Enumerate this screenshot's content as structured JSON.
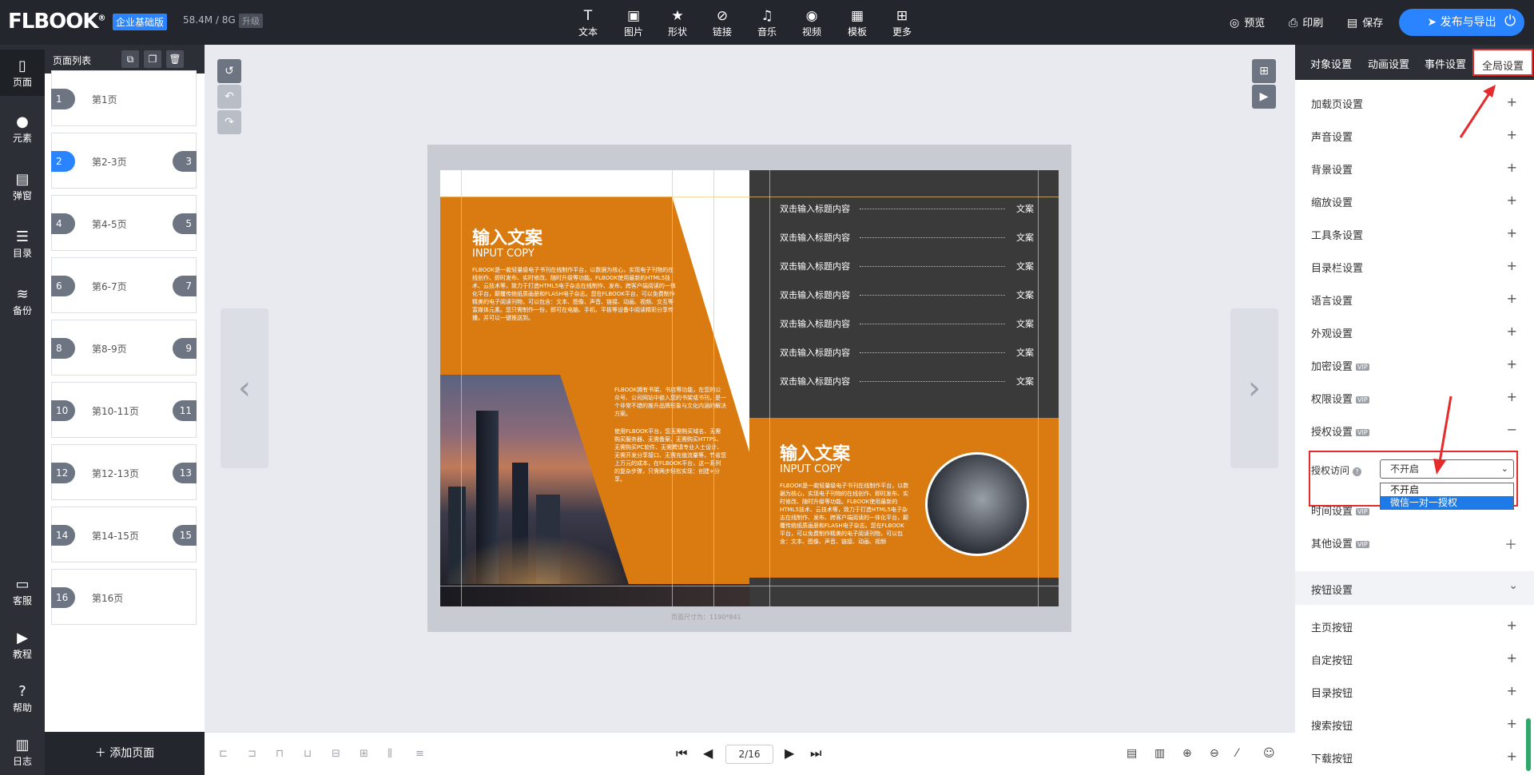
{
  "topbar": {
    "logo": "FLBOOK",
    "plan_badge": "企业基础版",
    "storage": "58.4M / 8G",
    "upgrade": "升级",
    "tools": [
      {
        "icon": "text-icon",
        "label": "文本"
      },
      {
        "icon": "image-icon",
        "label": "图片"
      },
      {
        "icon": "shape-icon",
        "label": "形状"
      },
      {
        "icon": "link-icon",
        "label": "链接"
      },
      {
        "icon": "music-icon",
        "label": "音乐"
      },
      {
        "icon": "video-icon",
        "label": "视频"
      },
      {
        "icon": "template-icon",
        "label": "模板"
      },
      {
        "icon": "more-icon",
        "label": "更多"
      }
    ],
    "preview": "预览",
    "print": "印刷",
    "save": "保存",
    "publish": "发布与导出"
  },
  "leftnav": [
    {
      "icon": "page-icon",
      "label": "页面"
    },
    {
      "icon": "element-icon",
      "label": "元素"
    },
    {
      "icon": "popup-icon",
      "label": "弹窗"
    },
    {
      "icon": "toc-icon",
      "label": "目录"
    },
    {
      "icon": "backup-icon",
      "label": "备份"
    },
    {
      "icon": "service-icon",
      "label": "客服"
    },
    {
      "icon": "tutorial-icon",
      "label": "教程"
    },
    {
      "icon": "help-icon",
      "label": "帮助"
    },
    {
      "icon": "log-icon",
      "label": "日志"
    }
  ],
  "pagelist": {
    "title": "页面列表",
    "pages": [
      {
        "left": "1",
        "right": "",
        "label": "第1页",
        "active": false
      },
      {
        "left": "2",
        "right": "3",
        "label": "第2-3页",
        "active": true
      },
      {
        "left": "4",
        "right": "5",
        "label": "第4-5页",
        "active": false
      },
      {
        "left": "6",
        "right": "7",
        "label": "第6-7页",
        "active": false
      },
      {
        "left": "8",
        "right": "9",
        "label": "第8-9页",
        "active": false
      },
      {
        "left": "10",
        "right": "11",
        "label": "第10-11页",
        "active": false
      },
      {
        "left": "12",
        "right": "13",
        "label": "第12-13页",
        "active": false
      },
      {
        "left": "14",
        "right": "15",
        "label": "第14-15页",
        "active": false
      },
      {
        "left": "16",
        "right": "",
        "label": "第16页",
        "active": false
      }
    ],
    "add_page": "添加页面"
  },
  "spread": {
    "left_title": "输入文案",
    "left_sub": "INPUT COPY",
    "left_body": "FLBOOK是一款轻量级电子书刊在线制作平台，以数据为核心，实现电子刊物的在线创作、即时发布、实时修改、随时升级等功能。FLBOOK使用最新的HTML5技术、云技术等，致力于打造HTML5电子杂志在线制作、发布、跨客户端阅读的一体化平台，颠覆传统纸质画册和FLASH电子杂志。您在FLBOOK平台，可以免费制作精美的电子阅读刊物，可以包含：文本、图像、声音、链接、动画、视频、交互等富媒体元素。您只需制作一份，即可在电脑、手机、平板等设备中阅读精彩分享传播，并可以一键推送到。",
    "left_body2": "FLBOOK拥有书架、书店等功能，在您的公众号、公司网站中嵌入您的书架或书刊，是一个非常不错的推升品牌形象与文化内涵的解决方案。",
    "left_body3": "使用FLBOOK平台，您无需购买域名、无需购买服务器、无需备案、无需购买HTTPS、无需购买PC软件、无需聘请专业人士设计、无需开发分享接口、无需充值流量等，节省您上万元的成本，在FLBOOK平台，这一系列的复杂步骤，只需两步轻松实现：创建+分享。",
    "toc": [
      {
        "title": "双击输入标题内容",
        "page": "文案"
      },
      {
        "title": "双击输入标题内容",
        "page": "文案"
      },
      {
        "title": "双击输入标题内容",
        "page": "文案"
      },
      {
        "title": "双击输入标题内容",
        "page": "文案"
      },
      {
        "title": "双击输入标题内容",
        "page": "文案"
      },
      {
        "title": "双击输入标题内容",
        "page": "文案"
      },
      {
        "title": "双击输入标题内容",
        "page": "文案"
      }
    ],
    "right_title": "输入文案",
    "right_sub": "INPUT COPY",
    "right_body": "FLBOOK是一款轻量级电子书刊在线制作平台，以数据为核心，实现电子刊物的在线创作、即时发布、实时修改、随时升级等功能。FLBOOK使用最新的HTML5技术、云技术等，致力于打造HTML5电子杂志在线制作、发布、跨客户端阅读的一体化平台，颠覆传统纸质画册和FLASH电子杂志。您在FLBOOK平台，可以免费制作精美的电子阅读刊物，可以包含：文本、图像、声音、链接、动画、视频",
    "page_size": "页面尺寸为：1190*841"
  },
  "bottombar": {
    "page_indicator": "2/16"
  },
  "rightpanel": {
    "tabs": [
      "对象设置",
      "动画设置",
      "事件设置",
      "全局设置"
    ],
    "active_tab": "全局设置",
    "settings": [
      {
        "label": "加载页设置",
        "vip": false,
        "toggle": "+"
      },
      {
        "label": "声音设置",
        "vip": false,
        "toggle": "+"
      },
      {
        "label": "背景设置",
        "vip": false,
        "toggle": "+"
      },
      {
        "label": "缩放设置",
        "vip": false,
        "toggle": "+"
      },
      {
        "label": "工具条设置",
        "vip": false,
        "toggle": "+"
      },
      {
        "label": "目录栏设置",
        "vip": false,
        "toggle": "+"
      },
      {
        "label": "语言设置",
        "vip": false,
        "toggle": "+"
      },
      {
        "label": "外观设置",
        "vip": false,
        "toggle": "+"
      },
      {
        "label": "加密设置",
        "vip": true,
        "toggle": "+"
      },
      {
        "label": "权限设置",
        "vip": true,
        "toggle": "+"
      },
      {
        "label": "授权设置",
        "vip": true,
        "toggle": "−"
      }
    ],
    "vip_tag": "VIP",
    "auth_label": "授权访问",
    "auth_selected": "不开启",
    "auth_options": [
      "不开启",
      "微信一对一授权"
    ],
    "time_setting": "时间设置",
    "other_setting": "其他设置",
    "button_section": "按钮设置",
    "button_settings": [
      "主页按钮",
      "自定按钮",
      "目录按钮",
      "搜索按钮",
      "下载按钮"
    ]
  }
}
